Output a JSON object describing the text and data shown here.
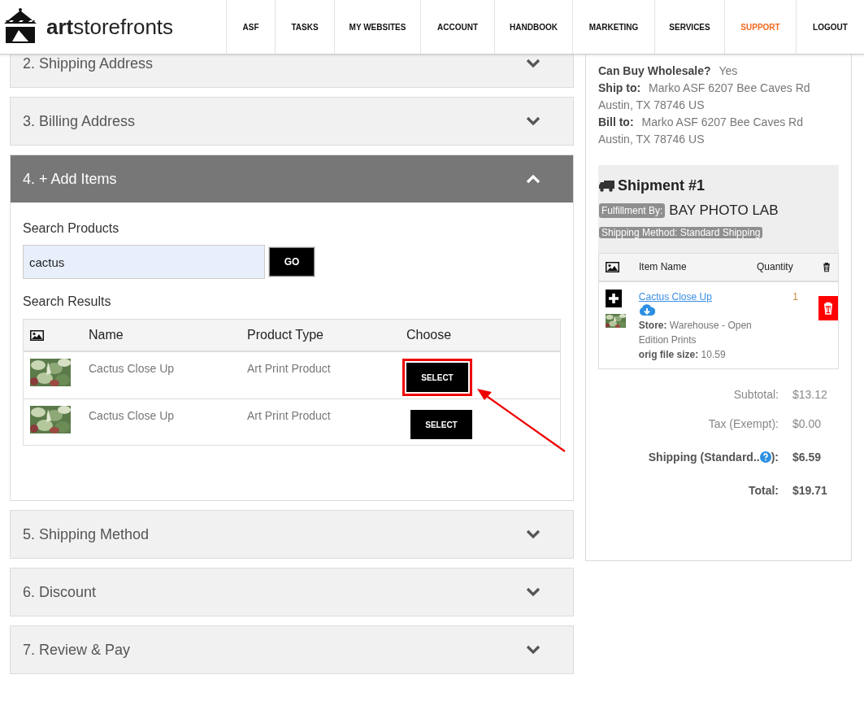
{
  "header": {
    "logo": {
      "bold": "art",
      "rest": "storefronts"
    },
    "nav": [
      {
        "label": "ASF",
        "selected": false
      },
      {
        "label": "TASKS",
        "selected": false
      },
      {
        "label": "MY WEBSITES",
        "selected": false
      },
      {
        "label": "ACCOUNT",
        "selected": false
      },
      {
        "label": "HANDBOOK",
        "selected": false
      },
      {
        "label": "MARKETING",
        "selected": false
      },
      {
        "label": "SERVICES",
        "selected": false
      },
      {
        "label": "SUPPORT",
        "selected": true
      },
      {
        "label": "LOGOUT",
        "selected": false
      }
    ]
  },
  "steps": [
    {
      "title": "2. Shipping Address",
      "expanded": false
    },
    {
      "title": "3. Billing Address",
      "expanded": false
    },
    {
      "title": "4. + Add Items",
      "expanded": true,
      "search_label": "Search Products",
      "search": {
        "value": "cactus"
      },
      "go": "GO",
      "results_label": "Search Results",
      "columns": [
        "Name",
        "Product Type",
        "Choose"
      ],
      "rows": [
        {
          "kind": "picture",
          "name": "Cactus Close Up",
          "type": "Art Print Product",
          "button": "SELECT",
          "highlighted": true
        },
        {
          "kind": "picture",
          "name": "Cactus Close Up",
          "type": "Art Print Product",
          "button": "SELECT",
          "highlighted": false
        }
      ]
    },
    {
      "title": "5. Shipping Method",
      "expanded": false
    },
    {
      "title": "6. Discount",
      "expanded": false
    },
    {
      "title": "7. Review & Pay",
      "expanded": false
    }
  ],
  "summary": {
    "details": [
      {
        "label": "Can Buy Wholesale?",
        "value": "Yes"
      },
      {
        "label": "Ship to:",
        "value": "Marko ASF 6207 Bee Caves Rd Austin, TX 78746 US"
      },
      {
        "label": "Bill to:",
        "value": "Marko ASF 6207 Bee Caves Rd Austin, TX 78746 US"
      }
    ],
    "shipment": {
      "title": "Shipment #1",
      "fulfillment_label": "Fulfillment By:",
      "fulfillment": "BAY PHOTO LAB",
      "method": "Shipping Method: Standard Shipping",
      "columns": [
        "Item Name",
        "Quantity"
      ],
      "items": [
        {
          "name": "Cactus Close Up",
          "store_label": "Store:",
          "store": "Warehouse - Open Edition Prints",
          "size_label": "orig file size:",
          "size": "10.59",
          "quantity": "1"
        }
      ]
    },
    "totals": [
      {
        "label": "Subtotal:",
        "value": "$13.12",
        "bold": false,
        "help": false
      },
      {
        "label": "Tax (Exempt):",
        "value": "$0.00",
        "bold": false,
        "help": false
      },
      {
        "label": "Shipping (Standard..",
        "label_end": "):",
        "value": "$6.59",
        "bold": true,
        "help": true
      },
      {
        "label": "Total:",
        "value": "$19.71",
        "bold": true,
        "help": false
      }
    ]
  }
}
